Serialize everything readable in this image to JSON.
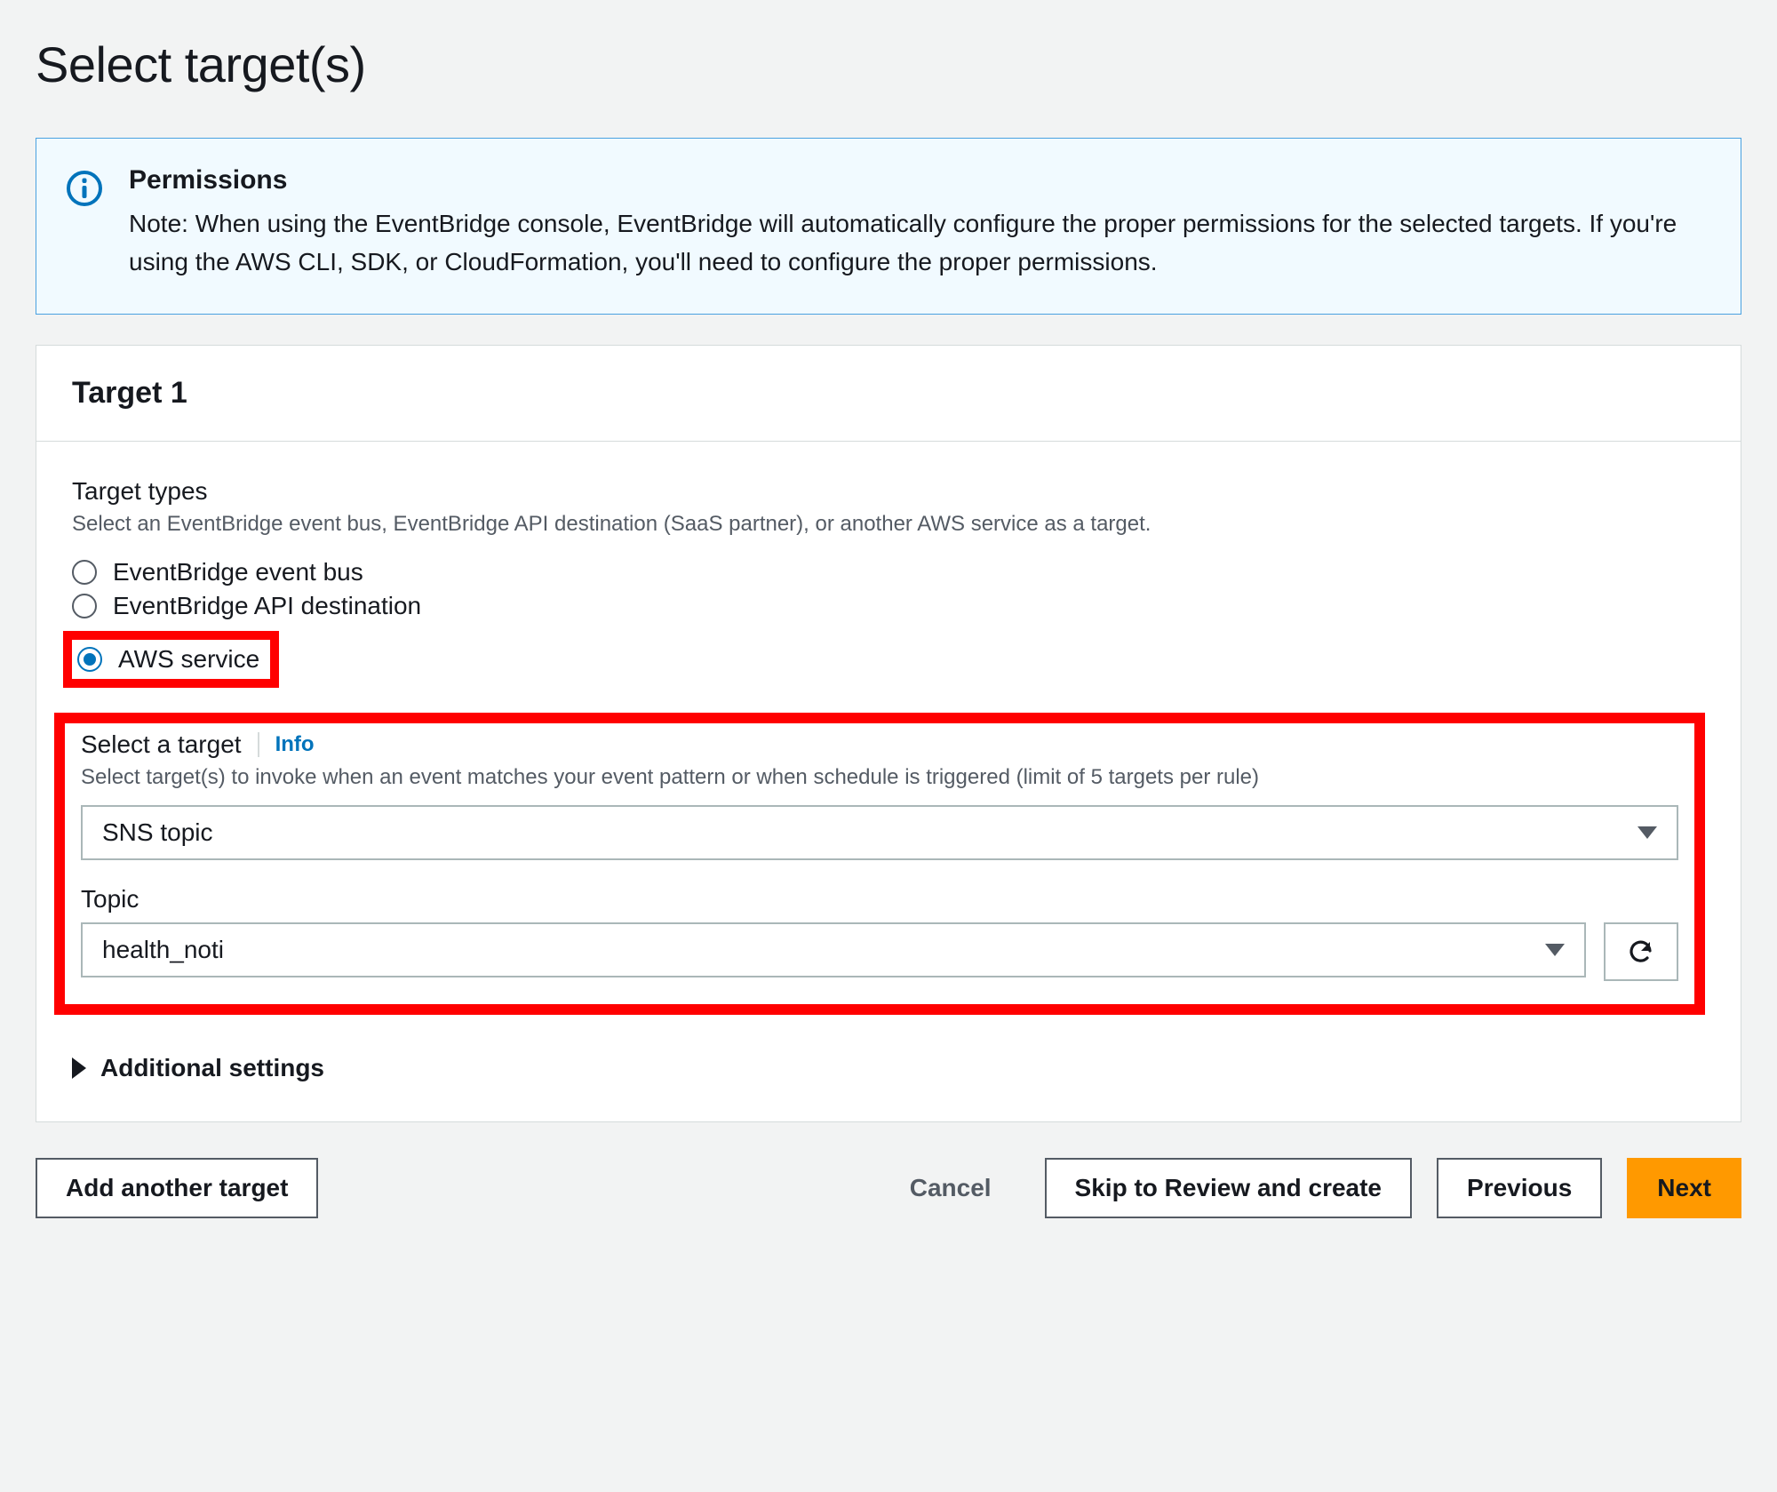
{
  "page_title": "Select target(s)",
  "permissions": {
    "title": "Permissions",
    "note": "Note: When using the EventBridge console, EventBridge will automatically configure the proper permissions for the selected targets. If you're using the AWS CLI, SDK, or CloudFormation, you'll need to configure the proper permissions."
  },
  "target_panel": {
    "header": "Target 1",
    "target_types": {
      "title": "Target types",
      "description": "Select an EventBridge event bus, EventBridge API destination (SaaS partner), or another AWS service as a target.",
      "options": {
        "event_bus": "EventBridge event bus",
        "api_destination": "EventBridge API destination",
        "aws_service": "AWS service"
      },
      "selected": "aws_service"
    },
    "select_target": {
      "title": "Select a target",
      "info_label": "Info",
      "description": "Select target(s) to invoke when an event matches your event pattern or when schedule is triggered (limit of 5 targets per rule)",
      "target_value": "SNS topic",
      "topic_label": "Topic",
      "topic_value": "health_noti"
    },
    "additional_settings_label": "Additional settings"
  },
  "footer": {
    "add_another": "Add another target",
    "cancel": "Cancel",
    "skip": "Skip to Review and create",
    "previous": "Previous",
    "next": "Next"
  }
}
